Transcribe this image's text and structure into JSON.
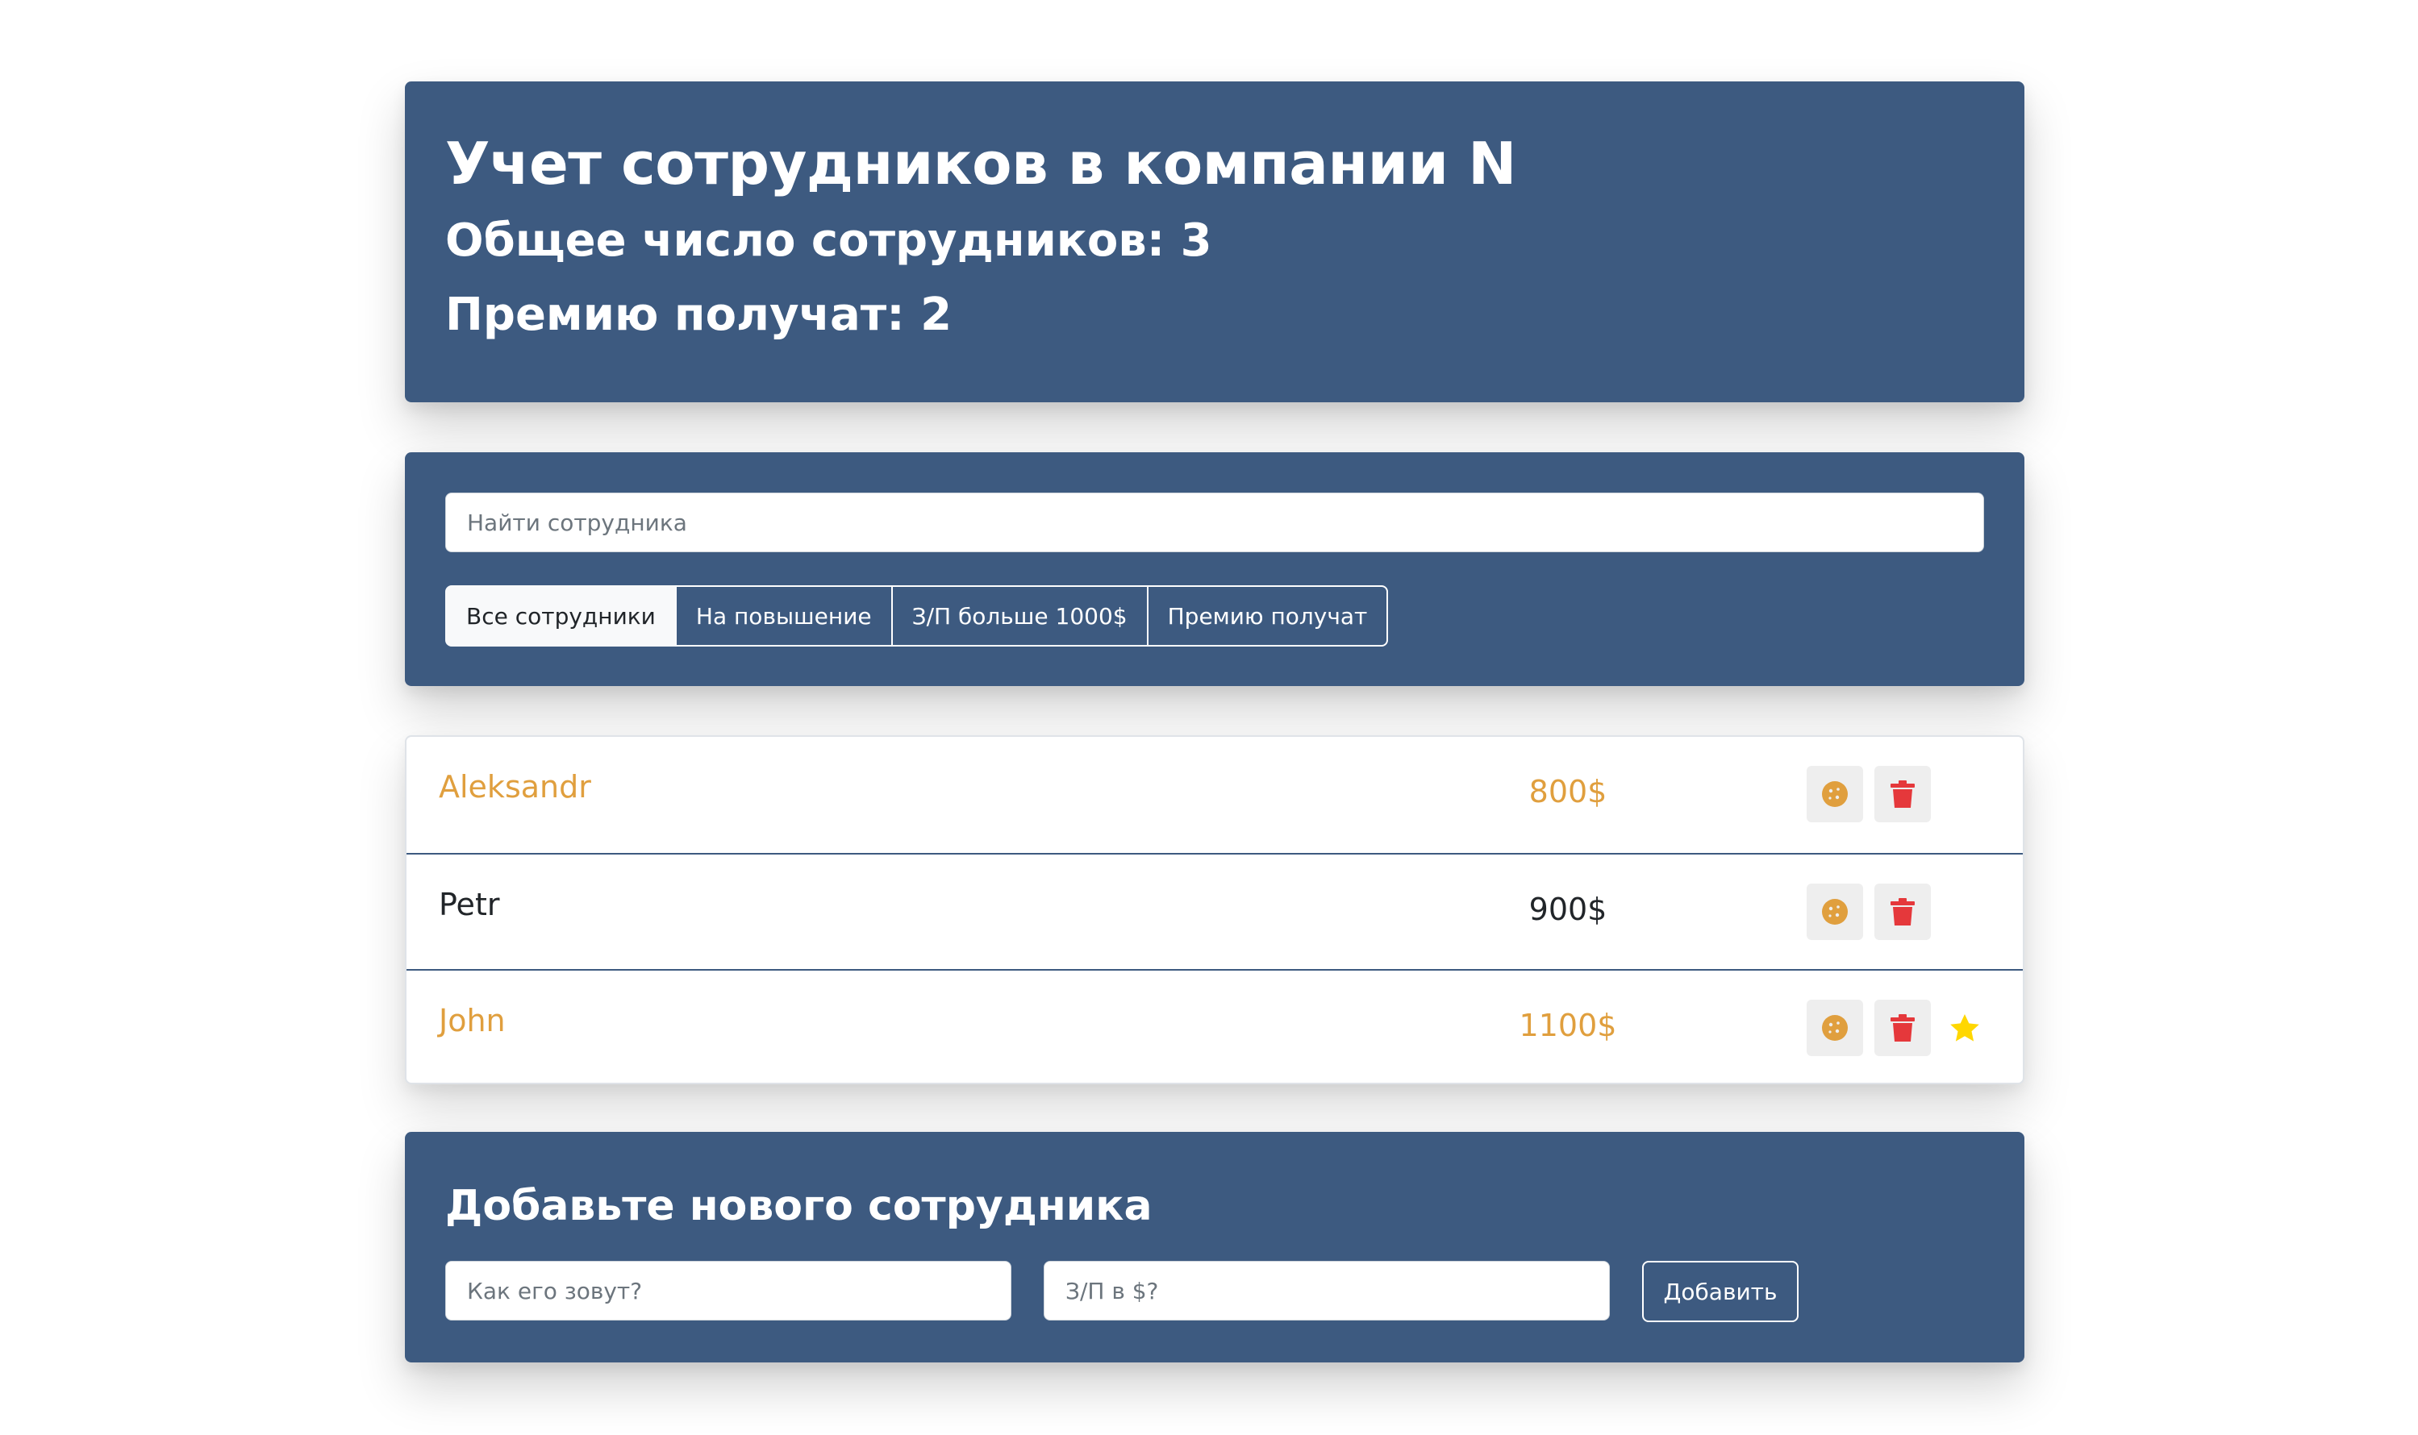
{
  "header": {
    "title": "Учет сотрудников в компании N",
    "total_label": "Общее число сотрудников: 3",
    "bonus_label": "Премию получат: 2"
  },
  "search": {
    "placeholder": "Найти сотрудника",
    "value": ""
  },
  "filters": [
    {
      "label": "Все сотрудники",
      "active": true
    },
    {
      "label": "На повышение",
      "active": false
    },
    {
      "label": "З/П больше 1000$",
      "active": false
    },
    {
      "label": "Премию получат",
      "active": false
    }
  ],
  "employees": [
    {
      "name": "Aleksandr",
      "salary": "800$",
      "increase": true,
      "like": false
    },
    {
      "name": "Petr",
      "salary": "900$",
      "increase": false,
      "like": false
    },
    {
      "name": "John",
      "salary": "1100$",
      "increase": true,
      "like": true
    }
  ],
  "add_form": {
    "title": "Добавьте нового сотрудника",
    "name_placeholder": "Как его зовут?",
    "salary_placeholder": "З/П в $?",
    "submit_label": "Добавить"
  },
  "colors": {
    "panel_bg": "#3d5a80",
    "increase_text": "#e09f3e",
    "trash_red": "#e5383b",
    "star_gold": "#ffd700",
    "cookie_orange": "#e09f3e"
  },
  "icons": {
    "cookie": "cookie-icon",
    "trash": "trash-icon",
    "star": "star-icon"
  }
}
